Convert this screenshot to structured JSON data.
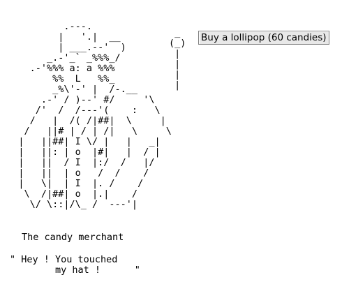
{
  "merchant": {
    "ascii_art": "           .---.\n          |   '.|  __\n          | ___.--'  )\n        _.-'_` _%%%_/\n     .-'%%% a: a %%%\n         %%  L   %%_\n         _%\\'-' |  /-.__\n       .-' / )--' #/     '\\\n      /'  /  /---'(    :   \\\n     /   |  /( /|##|  \\     |\n    /   ||# | / | /|   \\     \\\n   |   ||##| I \\/ |   |   _|\n   |   ||: | o  |#|   |  / |\n   |   ||  / I  |:/  /   |/\n   |   ||  | o   /  /    /\n   |   \\|  | I  |. /    /\n    \\  /|##| o  |.|    /\n     \\/ \\::|/\\_ /  ---'|",
    "name": "The candy merchant",
    "speech": "\" Hey ! You touched\n        my hat !      \""
  },
  "lollipop": {
    "ascii_art": " _\n(_)\n |\n |\n |\n |"
  },
  "buttons": {
    "buy_lollipop": "Buy a lollipop (60 candies)"
  }
}
